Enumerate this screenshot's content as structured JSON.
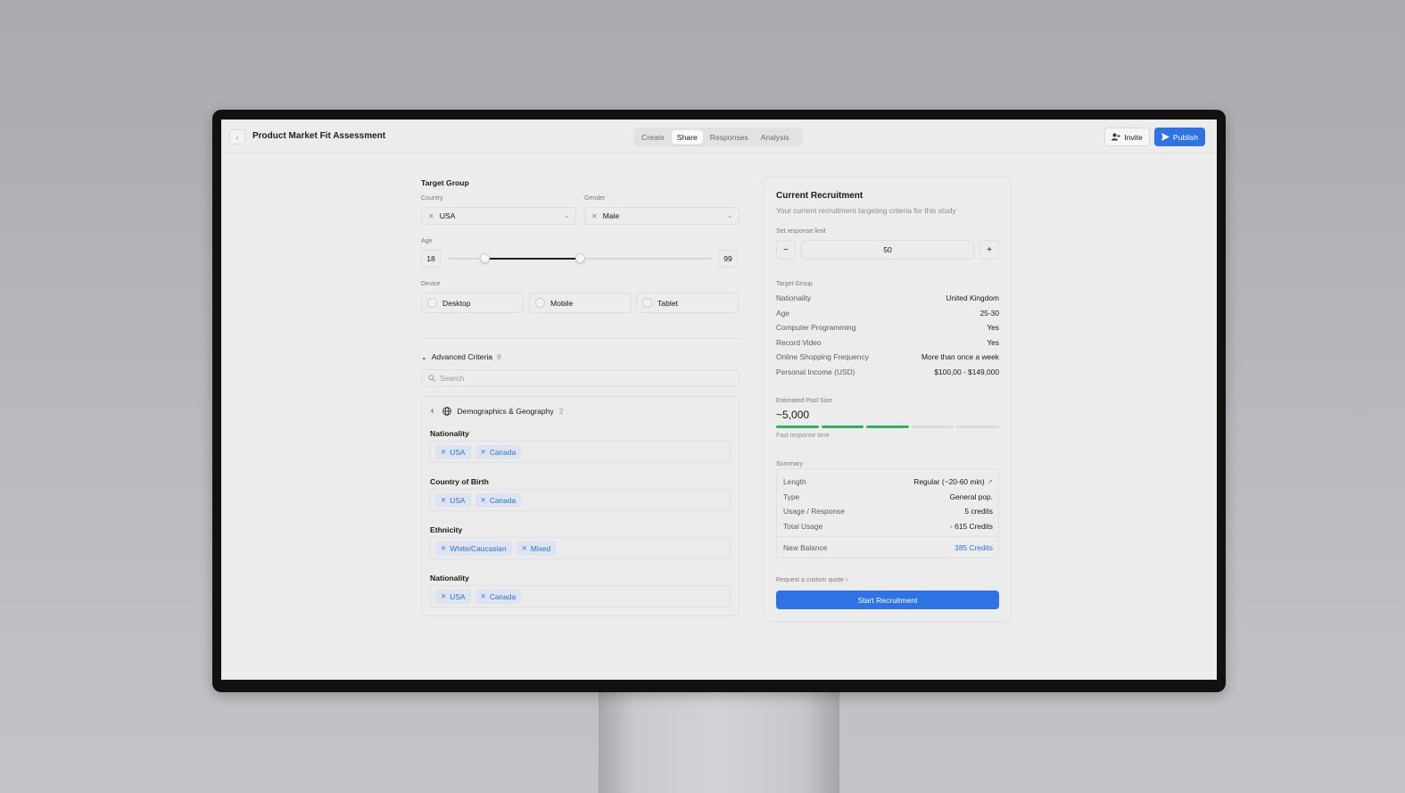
{
  "header": {
    "back_icon": "chevron-left-icon",
    "title": "Product Market Fit Assessment",
    "tabs": [
      {
        "label": "Create",
        "active": false
      },
      {
        "label": "Share",
        "active": true
      },
      {
        "label": "Responses",
        "active": false
      },
      {
        "label": "Analysis",
        "active": false
      }
    ],
    "invite_label": "Invite",
    "publish_label": "Publish"
  },
  "target_group": {
    "title": "Target Group",
    "country": {
      "label": "Country",
      "value": "USA"
    },
    "gender": {
      "label": "Gender",
      "value": "Male"
    },
    "age": {
      "label": "Age",
      "min": "18",
      "max": "99",
      "range_start_fraction": 0.14,
      "range_end_fraction": 0.5
    },
    "device": {
      "label": "Device",
      "options": [
        "Desktop",
        "Mobile",
        "Tablet"
      ]
    }
  },
  "advanced": {
    "title": "Advanced Criteria",
    "count": "8",
    "search_placeholder": "Search",
    "category": {
      "title": "Demographics & Geography",
      "count": "2"
    },
    "criteria": [
      {
        "label": "Nationality",
        "chips": [
          "USA",
          "Canada"
        ]
      },
      {
        "label": "Country of Birth",
        "chips": [
          "USA",
          "Canada"
        ]
      },
      {
        "label": "Ethnicity",
        "chips": [
          "White/Caucasian",
          "Mixed"
        ]
      },
      {
        "label": "Nationality",
        "chips": [
          "USA",
          "Canada"
        ]
      }
    ]
  },
  "recruitment": {
    "title": "Current Recruitment",
    "subtitle": "Your current recruitment targeting criteria for this study",
    "limit_label": "Set response limit",
    "limit_value": "50",
    "minus": "−",
    "plus": "+",
    "target_title": "Target Group",
    "target_rows": [
      {
        "k": "Nationality",
        "v": "United Kingdom"
      },
      {
        "k": "Age",
        "v": "25-30"
      },
      {
        "k": "Computer Programming",
        "v": "Yes"
      },
      {
        "k": "Record Video",
        "v": "Yes"
      },
      {
        "k": "Online Shopping Frequency",
        "v": "More than once a week"
      },
      {
        "k": "Personal Income (USD)",
        "v": "$100,00 - $149,000"
      }
    ],
    "pool_label": "Estimated Pool Size",
    "pool_value": "~5,000",
    "pool_level": 3,
    "pool_segments": 5,
    "pool_note": "Fast response time",
    "summary_label": "Summary",
    "summary_rows": [
      {
        "k": "Length",
        "v": "Regular (~20-60 min)"
      },
      {
        "k": "Type",
        "v": "General pop."
      },
      {
        "k": "Usage / Response",
        "v": "5 credits"
      },
      {
        "k": "Total Usage",
        "v": "- 615 Credits"
      }
    ],
    "balance": {
      "k": "New Balance",
      "v": "385 Credits"
    },
    "quote_label": "Request a custom quote",
    "start_label": "Start Recruitment",
    "colors": {
      "accent": "#2e73e6",
      "pool_active": "#2fb05a",
      "pool_inactive": "#dcdcdc"
    }
  }
}
